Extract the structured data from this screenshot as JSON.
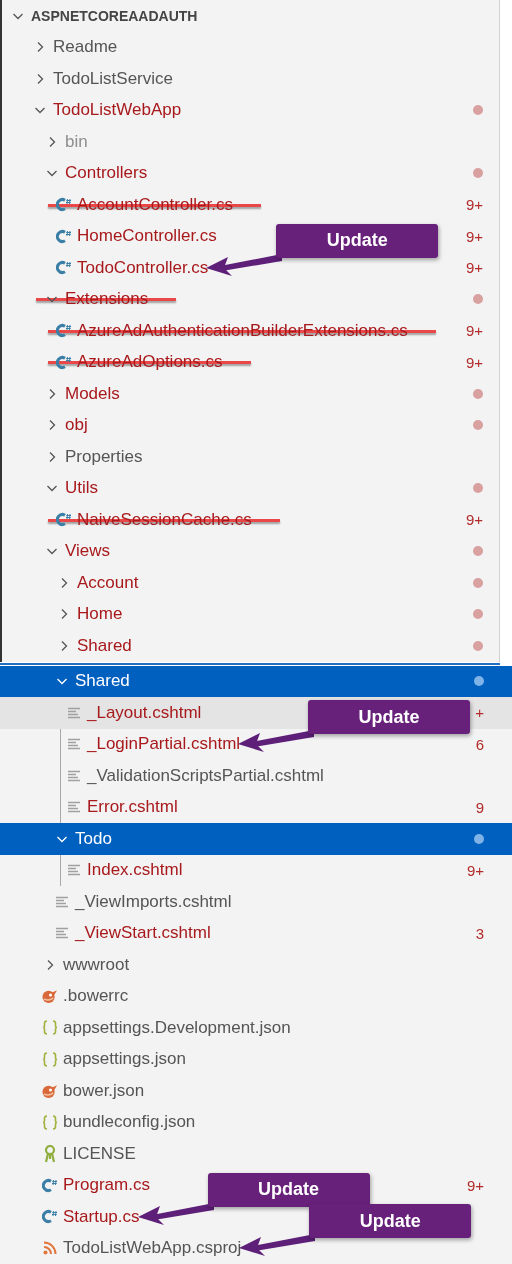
{
  "panels": [
    {
      "kind": "tree",
      "root": {
        "label": "ASPNETCOREAADAUTH",
        "expanded": true,
        "children": [
          {
            "label": "Readme",
            "kind": "folder",
            "expanded": false,
            "modified": false,
            "ignored": false,
            "selected": false
          },
          {
            "label": "TodoListService",
            "kind": "folder",
            "expanded": false,
            "modified": false,
            "ignored": false,
            "selected": false
          },
          {
            "label": "TodoListWebApp",
            "kind": "folder",
            "expanded": true,
            "modified": true,
            "ignored": false,
            "dot": true,
            "selected": false,
            "children": [
              {
                "label": "bin",
                "kind": "folder",
                "expanded": false,
                "modified": false,
                "ignored": true,
                "selected": false
              },
              {
                "label": "Controllers",
                "kind": "folder",
                "expanded": true,
                "modified": true,
                "ignored": false,
                "dot": true,
                "selected": false,
                "children": [
                  {
                    "label": "AccountController.cs",
                    "kind": "csharp",
                    "modified": true,
                    "ignored": false,
                    "badge": "9+",
                    "struck": true,
                    "selected": false
                  },
                  {
                    "label": "HomeController.cs",
                    "kind": "csharp",
                    "modified": true,
                    "ignored": false,
                    "badge": "9+",
                    "selected": false
                  },
                  {
                    "label": "TodoController.cs",
                    "kind": "csharp",
                    "modified": true,
                    "ignored": false,
                    "badge": "9+",
                    "callout": "Update",
                    "selected": false
                  }
                ]
              },
              {
                "label": "Extensions",
                "kind": "folder",
                "expanded": true,
                "modified": true,
                "ignored": false,
                "dot": true,
                "struck": true,
                "selected": false,
                "children": [
                  {
                    "label": "AzureAdAuthenticationBuilderExtensions.cs",
                    "kind": "csharp",
                    "modified": true,
                    "ignored": false,
                    "badge": "9+",
                    "struck": true,
                    "selected": false
                  },
                  {
                    "label": "AzureAdOptions.cs",
                    "kind": "csharp",
                    "modified": true,
                    "ignored": false,
                    "badge": "9+",
                    "struck": true,
                    "selected": false
                  }
                ]
              },
              {
                "label": "Models",
                "kind": "folder",
                "expanded": false,
                "modified": true,
                "ignored": false,
                "dot": true,
                "selected": false
              },
              {
                "label": "obj",
                "kind": "folder",
                "expanded": false,
                "modified": true,
                "ignored": false,
                "dot": true,
                "selected": false
              },
              {
                "label": "Properties",
                "kind": "folder",
                "expanded": false,
                "modified": false,
                "ignored": false,
                "selected": false
              },
              {
                "label": "Utils",
                "kind": "folder",
                "expanded": true,
                "modified": true,
                "ignored": false,
                "dot": true,
                "selected": false,
                "children": [
                  {
                    "label": "NaiveSessionCache.cs",
                    "kind": "csharp",
                    "modified": true,
                    "ignored": false,
                    "badge": "9+",
                    "struck": true,
                    "selected": false
                  }
                ]
              },
              {
                "label": "Views",
                "kind": "folder",
                "expanded": true,
                "modified": true,
                "ignored": false,
                "dot": true,
                "selected": false,
                "children": [
                  {
                    "label": "Account",
                    "kind": "folder",
                    "expanded": false,
                    "modified": true,
                    "ignored": false,
                    "dot": true,
                    "selected": false
                  },
                  {
                    "label": "Home",
                    "kind": "folder",
                    "expanded": false,
                    "modified": true,
                    "ignored": false,
                    "dot": true,
                    "selected": false
                  },
                  {
                    "label": "Shared",
                    "kind": "folder",
                    "expanded": false,
                    "modified": true,
                    "ignored": false,
                    "dot": true,
                    "selected": false
                  }
                ]
              }
            ]
          }
        ]
      }
    },
    {
      "kind": "fragment",
      "views_items": [
        {
          "label": "Shared",
          "kind": "folder",
          "expanded": true,
          "modified": true,
          "ignored": false,
          "dot": true,
          "selected": true,
          "children": [
            {
              "label": "_Layout.cshtml",
              "kind": "razor",
              "modified": true,
              "ignored": false,
              "badge": "+",
              "hovered": true,
              "selected": false
            },
            {
              "label": "_LoginPartial.cshtml",
              "kind": "razor",
              "modified": true,
              "ignored": false,
              "badge": "6",
              "callout": "Update",
              "selected": false
            },
            {
              "label": "_ValidationScriptsPartial.cshtml",
              "kind": "razor",
              "modified": false,
              "ignored": false,
              "selected": false
            },
            {
              "label": "Error.cshtml",
              "kind": "razor",
              "modified": true,
              "ignored": false,
              "badge": "9",
              "selected": false
            }
          ]
        },
        {
          "label": "Todo",
          "kind": "folder",
          "expanded": true,
          "modified": true,
          "ignored": false,
          "dot": true,
          "selected": true,
          "children": [
            {
              "label": "Index.cshtml",
              "kind": "razor",
              "modified": true,
              "ignored": false,
              "badge": "9+",
              "selected": false
            }
          ]
        },
        {
          "label": "_ViewImports.cshtml",
          "kind": "razor",
          "modified": false,
          "ignored": false,
          "selected": false
        },
        {
          "label": "_ViewStart.cshtml",
          "kind": "razor",
          "modified": true,
          "ignored": false,
          "badge": "3",
          "selected": false
        }
      ],
      "project_items": [
        {
          "label": "wwwroot",
          "kind": "folder",
          "expanded": false,
          "modified": false,
          "ignored": false,
          "selected": false
        },
        {
          "label": ".bowerrc",
          "kind": "bower",
          "modified": false,
          "ignored": false,
          "selected": false
        },
        {
          "label": "appsettings.Development.json",
          "kind": "json",
          "modified": false,
          "ignored": false,
          "selected": false
        },
        {
          "label": "appsettings.json",
          "kind": "json",
          "modified": false,
          "ignored": false,
          "selected": false
        },
        {
          "label": "bower.json",
          "kind": "bower",
          "modified": false,
          "ignored": false,
          "selected": false
        },
        {
          "label": "bundleconfig.json",
          "kind": "json",
          "modified": false,
          "ignored": false,
          "selected": false
        },
        {
          "label": "LICENSE",
          "kind": "license",
          "modified": false,
          "ignored": false,
          "selected": false
        },
        {
          "label": "Program.cs",
          "kind": "csharp",
          "modified": true,
          "ignored": false,
          "badge": "9+",
          "selected": false
        },
        {
          "label": "Startup.cs",
          "kind": "csharp",
          "modified": true,
          "ignored": false,
          "callout": "Update",
          "selected": false
        },
        {
          "label": "TodoListWebApp.csproj",
          "kind": "project",
          "modified": false,
          "ignored": false,
          "callout": "Update",
          "selected": false
        }
      ]
    }
  ]
}
